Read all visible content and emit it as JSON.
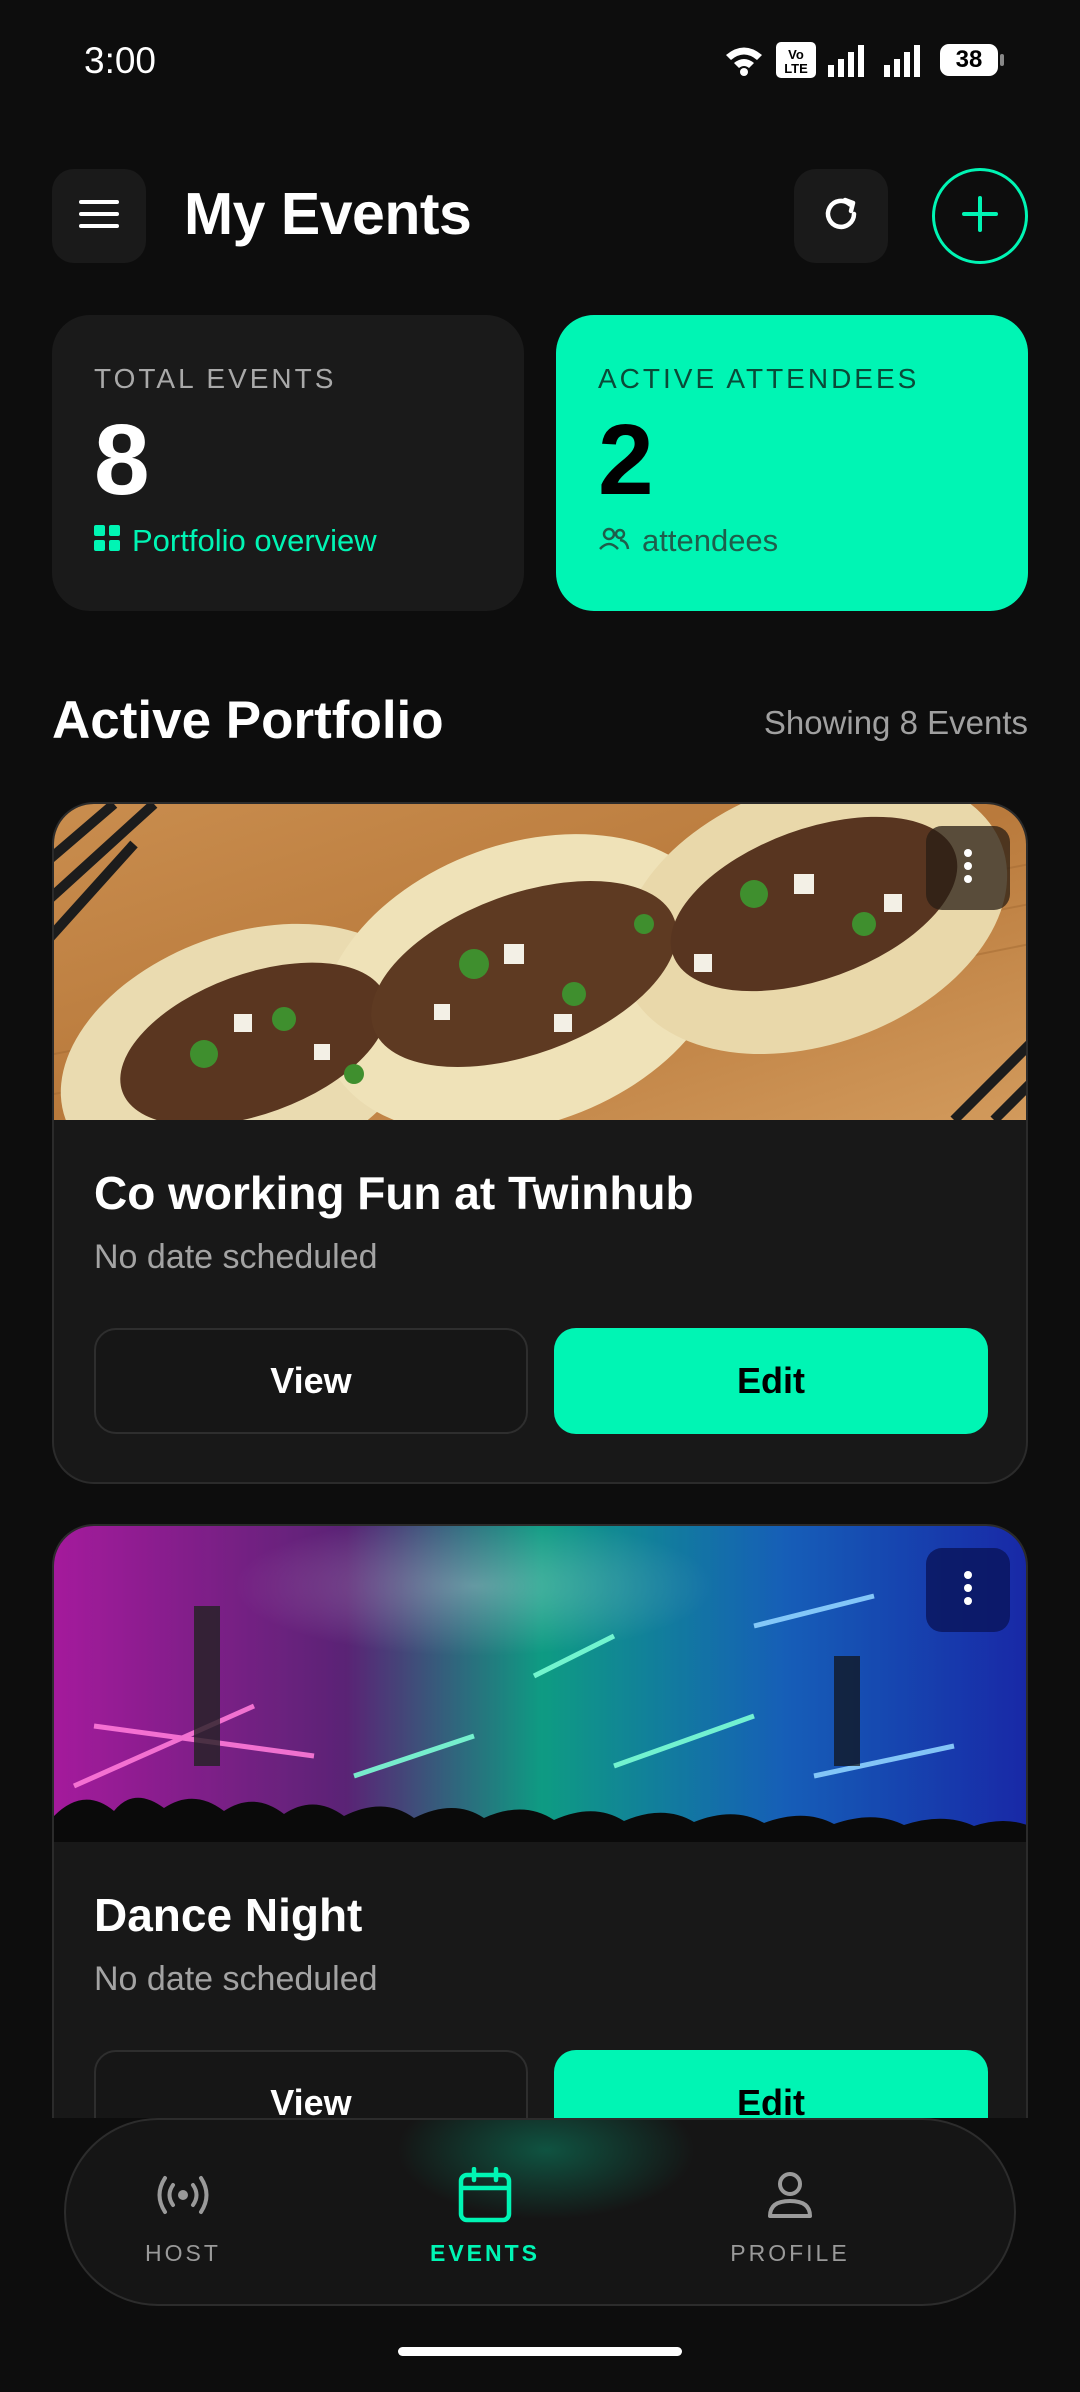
{
  "status_bar": {
    "time": "3:00",
    "volte_label": "Vo LTE",
    "battery": "38",
    "icons": [
      "wifi-icon",
      "volte-icon",
      "signal-icon",
      "signal-icon",
      "battery-icon"
    ]
  },
  "header": {
    "title": "My Events",
    "menu_icon": "hamburger-menu-icon",
    "refresh_icon": "refresh-icon",
    "add_icon": "plus-icon"
  },
  "stats": {
    "total": {
      "label": "TOTAL EVENTS",
      "value": "8",
      "footer": "Portfolio overview",
      "icon": "grid-icon"
    },
    "attendees": {
      "label": "ACTIVE ATTENDEES",
      "value": "2",
      "footer": "attendees",
      "icon": "people-icon"
    }
  },
  "section": {
    "title": "Active Portfolio",
    "count": "Showing 8 Events"
  },
  "events": [
    {
      "title": "Co working Fun at Twinhub",
      "date": "No date scheduled",
      "view_label": "View",
      "edit_label": "Edit",
      "image": "tacos-photo"
    },
    {
      "title": "Dance Night",
      "date": "No date scheduled",
      "view_label": "View",
      "edit_label": "Edit",
      "image": "concert-photo"
    }
  ],
  "nav": {
    "items": [
      {
        "label": "HOST",
        "icon": "broadcast-icon"
      },
      {
        "label": "EVENTS",
        "icon": "calendar-icon",
        "active": true
      },
      {
        "label": "PROFILE",
        "icon": "person-icon"
      }
    ]
  },
  "colors": {
    "accent": "#00f5b4",
    "background": "#0d0d0d",
    "card": "#181818"
  }
}
